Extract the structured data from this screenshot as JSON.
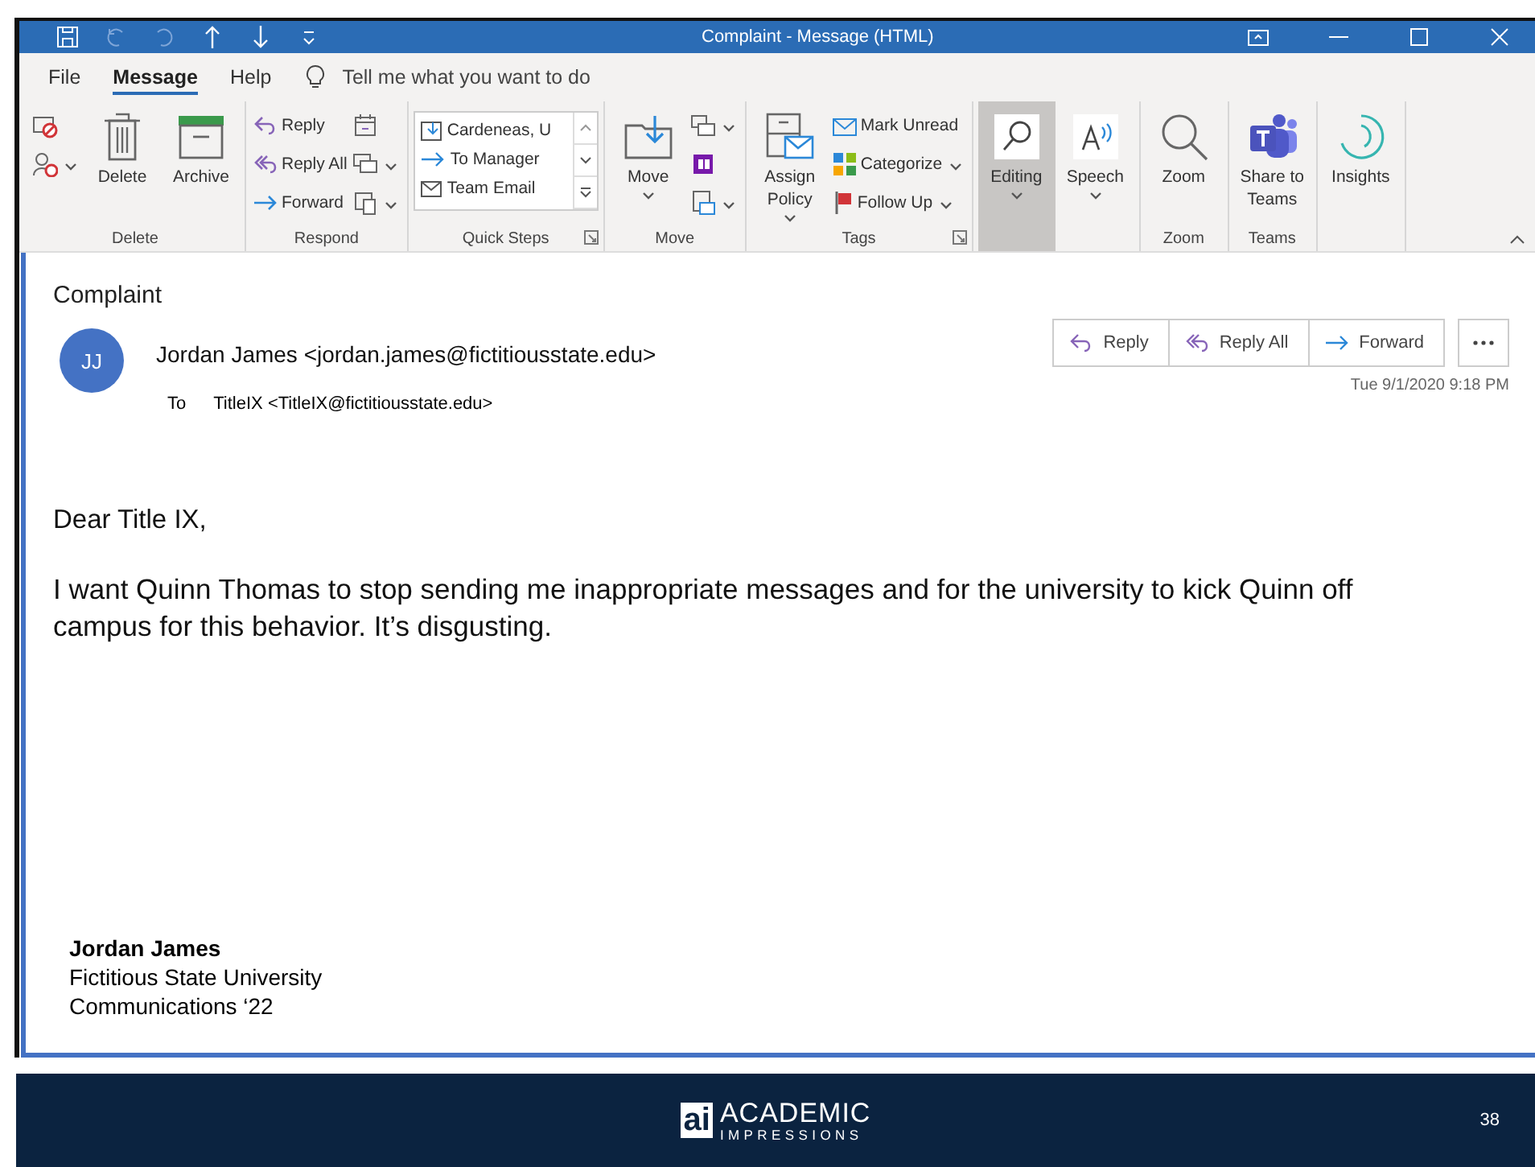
{
  "window": {
    "title": "Complaint  -  Message (HTML)"
  },
  "menu_tabs": [
    {
      "label": "File",
      "selected": false
    },
    {
      "label": "Message",
      "selected": true
    },
    {
      "label": "Help",
      "selected": false
    }
  ],
  "tell_me": {
    "placeholder": "Tell me what you want to do"
  },
  "ribbon_groups": [
    {
      "label": "Delete",
      "columns": [
        [
          {
            "kind": "small"
          },
          {
            "kind": "small",
            "dropdown": true
          }
        ],
        [
          {
            "kind": "large",
            "label": "Delete"
          }
        ],
        [
          {
            "kind": "large",
            "label": "Archive"
          }
        ]
      ]
    },
    {
      "label": "Respond",
      "columns": [
        [
          {
            "kind": "small",
            "label": "Reply"
          },
          {
            "kind": "small",
            "label": "Reply All"
          },
          {
            "kind": "small",
            "label": "Forward"
          }
        ],
        [
          {
            "kind": "small"
          },
          {
            "kind": "small",
            "dropdown": true
          },
          {
            "kind": "small",
            "dropdown": true
          }
        ]
      ]
    },
    {
      "label": "Quick Steps",
      "launcher": true,
      "columns": [
        [
          {
            "kind": "gallery",
            "items": [
              "Cardeneas, U",
              "To Manager",
              "Team Email"
            ]
          }
        ]
      ]
    },
    {
      "label": "Move",
      "columns": [
        [
          {
            "kind": "large",
            "label": "Move",
            "dropdown": true
          }
        ],
        [
          {
            "kind": "small",
            "dropdown": true
          },
          {
            "kind": "small"
          },
          {
            "kind": "small",
            "dropdown": true
          }
        ]
      ]
    },
    {
      "label": "Tags",
      "launcher": true,
      "columns": [
        [
          {
            "kind": "large",
            "label": "Assign Policy",
            "dropdown": true
          }
        ],
        [
          {
            "kind": "small",
            "label": "Mark Unread"
          },
          {
            "kind": "small",
            "label": "Categorize",
            "dropdown": true
          },
          {
            "kind": "small",
            "label": "Follow Up",
            "dropdown": true
          }
        ]
      ]
    },
    {
      "columns": [
        [
          {
            "kind": "large",
            "label": "Editing",
            "dropdown": true,
            "highlighted": true
          }
        ],
        [
          {
            "kind": "large",
            "label": "Speech",
            "dropdown": true
          }
        ]
      ]
    },
    {
      "label": "Zoom",
      "columns": [
        [
          {
            "kind": "large",
            "label": "Zoom"
          }
        ]
      ]
    },
    {
      "label": "Teams",
      "columns": [
        [
          {
            "kind": "large",
            "label": "Share to Teams"
          }
        ]
      ]
    },
    {
      "columns": [
        [
          {
            "kind": "large",
            "label": "Insights"
          }
        ]
      ]
    }
  ],
  "message": {
    "subject": "Complaint",
    "avatar_initials": "JJ",
    "sender": "Jordan James <jordan.james@fictitiousstate.edu>",
    "to_label": "To",
    "recipient": "TitleIX <TitleIX@fictitiousstate.edu>",
    "actions": [
      "Reply",
      "Reply All",
      "Forward"
    ],
    "date": "Tue 9/1/2020 9:18 PM",
    "greeting": "Dear Title IX,",
    "body": "I want Quinn Thomas to stop sending me inappropriate messages and for the university to kick Quinn off campus for this behavior.  It’s disgusting.",
    "signature": [
      "Jordan James",
      "Fictitious State University",
      "Communications ‘22"
    ]
  },
  "footer": {
    "logo_mark": "ai",
    "logo_top": "ACADEMIC",
    "logo_bottom": "IMPRESSIONS",
    "page_number": "38"
  }
}
